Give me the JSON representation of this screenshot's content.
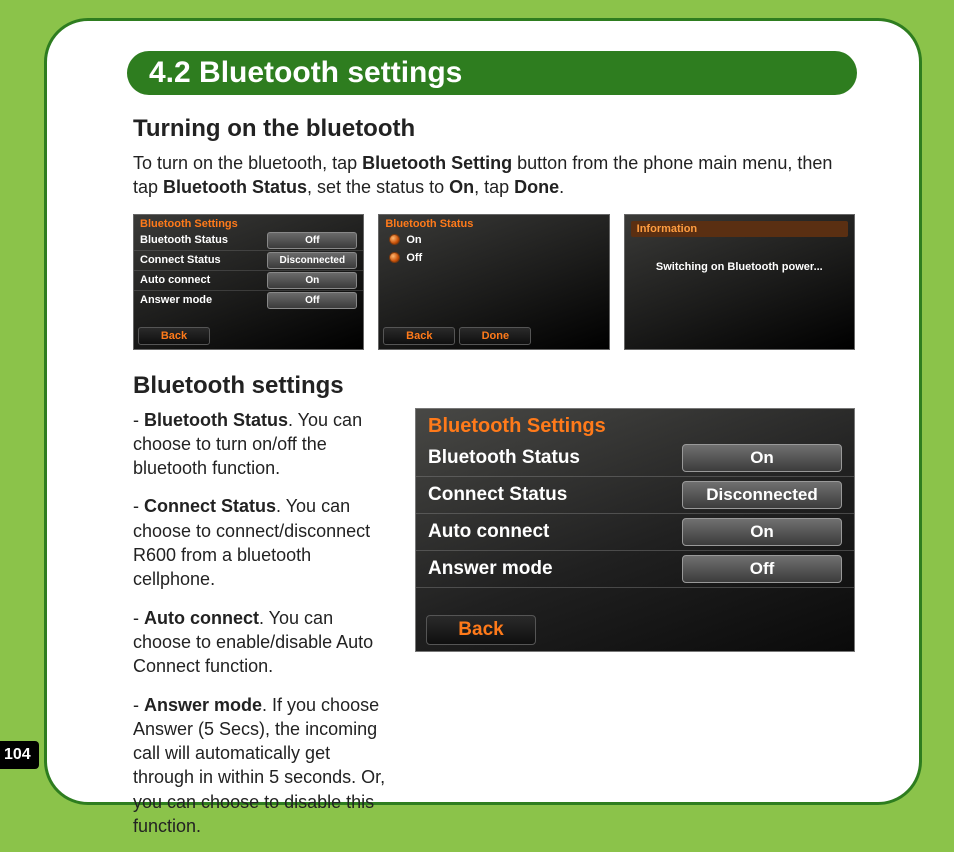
{
  "title": "4.2 Bluetooth settings",
  "page_number": "104",
  "section1": {
    "heading": "Turning on the bluetooth",
    "intro_parts": [
      "To turn on the bluetooth, tap ",
      "Bluetooth Setting",
      " button from the phone main menu, then tap ",
      "Bluetooth Status",
      ", set the status to ",
      "On",
      ", tap ",
      "Done",
      "."
    ]
  },
  "screenA": {
    "title": "Bluetooth Settings",
    "rows": [
      {
        "label": "Bluetooth Status",
        "value": "Off"
      },
      {
        "label": "Connect Status",
        "value": "Disconnected"
      },
      {
        "label": "Auto connect",
        "value": "On"
      },
      {
        "label": "Answer mode",
        "value": "Off"
      }
    ],
    "back": "Back"
  },
  "screenB": {
    "title": "Bluetooth Status",
    "options": [
      "On",
      "Off"
    ],
    "back": "Back",
    "done": "Done"
  },
  "screenC": {
    "title": "Information",
    "message": "Switching on Bluetooth power..."
  },
  "section2": {
    "heading": "Bluetooth settings",
    "items": [
      {
        "term": "Bluetooth Status",
        "desc": ". You can choose to turn on/off the bluetooth function."
      },
      {
        "term": "Connect Status",
        "desc": ". You can choose to connect/disconnect R600 from a bluetooth cellphone."
      },
      {
        "term": "Auto connect",
        "desc": ". You can choose to enable/disable Auto Connect function."
      },
      {
        "term": "Answer mode",
        "desc": ". If you choose Answer (5 Secs), the incoming call will automatically get through in within 5 seconds. Or, you can choose to disable this function."
      }
    ]
  },
  "big_screen": {
    "title": "Bluetooth Settings",
    "rows": [
      {
        "label": "Bluetooth Status",
        "value": "On"
      },
      {
        "label": "Connect Status",
        "value": "Disconnected"
      },
      {
        "label": "Auto connect",
        "value": "On"
      },
      {
        "label": "Answer mode",
        "value": "Off"
      }
    ],
    "back": "Back"
  }
}
